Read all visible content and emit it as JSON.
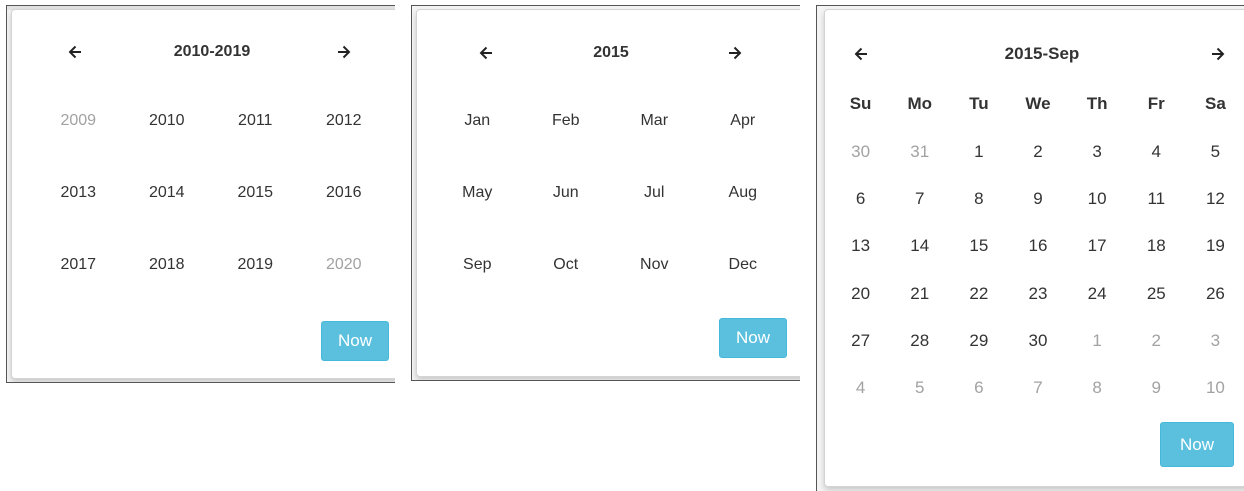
{
  "decade_picker": {
    "title": "2010-2019",
    "prev_icon": "arrow-left-icon",
    "next_icon": "arrow-right-icon",
    "years": [
      {
        "label": "2009",
        "muted": true
      },
      {
        "label": "2010",
        "muted": false
      },
      {
        "label": "2011",
        "muted": false
      },
      {
        "label": "2012",
        "muted": false
      },
      {
        "label": "2013",
        "muted": false
      },
      {
        "label": "2014",
        "muted": false
      },
      {
        "label": "2015",
        "muted": false
      },
      {
        "label": "2016",
        "muted": false
      },
      {
        "label": "2017",
        "muted": false
      },
      {
        "label": "2018",
        "muted": false
      },
      {
        "label": "2019",
        "muted": false
      },
      {
        "label": "2020",
        "muted": true
      }
    ],
    "now_label": "Now"
  },
  "year_picker": {
    "title": "2015",
    "prev_icon": "arrow-left-icon",
    "next_icon": "arrow-right-icon",
    "months": [
      "Jan",
      "Feb",
      "Mar",
      "Apr",
      "May",
      "Jun",
      "Jul",
      "Aug",
      "Sep",
      "Oct",
      "Nov",
      "Dec"
    ],
    "now_label": "Now"
  },
  "month_picker": {
    "title": "2015-Sep",
    "prev_icon": "arrow-left-icon",
    "next_icon": "arrow-right-icon",
    "weekdays": [
      "Su",
      "Mo",
      "Tu",
      "We",
      "Th",
      "Fr",
      "Sa"
    ],
    "days": [
      {
        "label": "30",
        "muted": true
      },
      {
        "label": "31",
        "muted": true
      },
      {
        "label": "1",
        "muted": false
      },
      {
        "label": "2",
        "muted": false
      },
      {
        "label": "3",
        "muted": false
      },
      {
        "label": "4",
        "muted": false
      },
      {
        "label": "5",
        "muted": false
      },
      {
        "label": "6",
        "muted": false
      },
      {
        "label": "7",
        "muted": false
      },
      {
        "label": "8",
        "muted": false
      },
      {
        "label": "9",
        "muted": false
      },
      {
        "label": "10",
        "muted": false
      },
      {
        "label": "11",
        "muted": false
      },
      {
        "label": "12",
        "muted": false
      },
      {
        "label": "13",
        "muted": false
      },
      {
        "label": "14",
        "muted": false
      },
      {
        "label": "15",
        "muted": false
      },
      {
        "label": "16",
        "muted": false
      },
      {
        "label": "17",
        "muted": false
      },
      {
        "label": "18",
        "muted": false
      },
      {
        "label": "19",
        "muted": false
      },
      {
        "label": "20",
        "muted": false
      },
      {
        "label": "21",
        "muted": false
      },
      {
        "label": "22",
        "muted": false
      },
      {
        "label": "23",
        "muted": false
      },
      {
        "label": "24",
        "muted": false
      },
      {
        "label": "25",
        "muted": false
      },
      {
        "label": "26",
        "muted": false
      },
      {
        "label": "27",
        "muted": false
      },
      {
        "label": "28",
        "muted": false
      },
      {
        "label": "29",
        "muted": false
      },
      {
        "label": "30",
        "muted": false
      },
      {
        "label": "1",
        "muted": true
      },
      {
        "label": "2",
        "muted": true
      },
      {
        "label": "3",
        "muted": true
      },
      {
        "label": "4",
        "muted": true
      },
      {
        "label": "5",
        "muted": true
      },
      {
        "label": "6",
        "muted": true
      },
      {
        "label": "7",
        "muted": true
      },
      {
        "label": "8",
        "muted": true
      },
      {
        "label": "9",
        "muted": true
      },
      {
        "label": "10",
        "muted": true
      }
    ],
    "now_label": "Now"
  },
  "colors": {
    "accent": "#5bc0de",
    "muted_text": "#a2a2a2",
    "text": "#333333"
  }
}
